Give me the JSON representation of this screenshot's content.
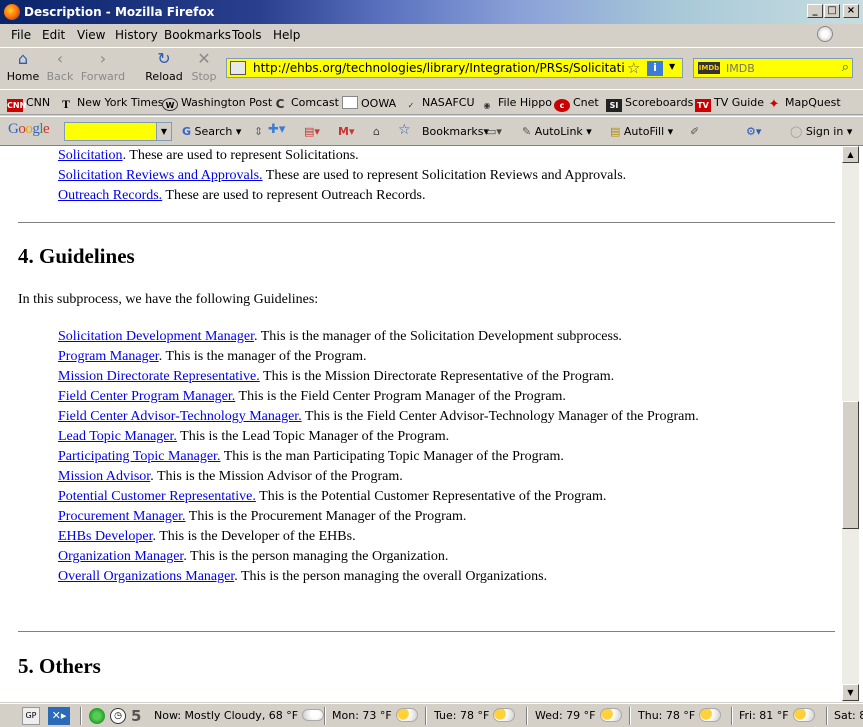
{
  "window": {
    "title": "Description - Mozilla Firefox"
  },
  "menu": [
    "File",
    "Edit",
    "View",
    "History",
    "Bookmarks",
    "Tools",
    "Help"
  ],
  "nav": {
    "home": "Home",
    "back": "Back",
    "forward": "Forward",
    "reload": "Reload",
    "stop": "Stop",
    "url": "http://ehbs.org/technologies/library/Integration/PRSs/Solicitation Developme",
    "search_placeholder": "IMDB",
    "search_engine": "IMDb"
  },
  "bookmarks": [
    "CNN",
    "New York Times",
    "Washington Post",
    "Comcast",
    "OOWA",
    "NASAFCU",
    "File Hippo",
    "Cnet",
    "Scoreboards",
    "TV Guide",
    "MapQuest"
  ],
  "google_toolbar": {
    "logo": "Google",
    "search": "Search",
    "bookmarks": "Bookmarks",
    "autolink": "AutoLink",
    "autofill": "AutoFill",
    "signin": "Sign in"
  },
  "content": {
    "top_items": [
      {
        "link": "Solicitation",
        "text": ". These are used to represent Solicitations."
      },
      {
        "link": "Solicitation Reviews and Approvals.",
        "text": " These are used to represent Solicitation Reviews and Approvals."
      },
      {
        "link": "Outreach Records.",
        "text": " These are used to represent Outreach Records."
      }
    ],
    "section4_heading": "4. Guidelines",
    "section4_intro": "In this subprocess, we have the following Guidelines:",
    "guidelines": [
      {
        "link": "Solicitation Development Manager",
        "text": ". This is the manager of the Solicitation Development subprocess."
      },
      {
        "link": "Program Manager",
        "text": ". This is the manager of the Program."
      },
      {
        "link": "Mission Directorate Representative.",
        "text": " This is the Mission Directorate Representative of the Program."
      },
      {
        "link": "Field Center Program Manager.",
        "text": " This is the Field Center Program Manager of the Program."
      },
      {
        "link": "Field Center Advisor-Technology Manager.",
        "text": " This is the Field Center Advisor-Technology Manager of the Program."
      },
      {
        "link": "Lead Topic Manager.",
        "text": " This is the Lead Topic Manager of the Program."
      },
      {
        "link": "Participating Topic Manager.",
        "text": " This is the man Participating Topic Manager of the Program."
      },
      {
        "link": "Mission Advisor",
        "text": ". This is the Mission Advisor of the Program."
      },
      {
        "link": "Potential Customer Representative.",
        "text": " This is the Potential Customer Representative of the Program."
      },
      {
        "link": "Procurement Manager.",
        "text": " This is the Procurement Manager of the Program."
      },
      {
        "link": "EHBs Developer",
        "text": ". This is the Developer of the EHBs."
      },
      {
        "link": "Organization Manager",
        "text": ". This is the person managing the Organization."
      },
      {
        "link": "Overall Organizations Manager",
        "text": ". This is the person managing the overall Organizations."
      }
    ],
    "section5_heading": "5. Others"
  },
  "status": {
    "gp": "GP",
    "count": "5",
    "now": "Now: Mostly Cloudy, 68 °F",
    "forecast": [
      "Mon: 73 °F",
      "Tue: 78 °F",
      "Wed: 79 °F",
      "Thu: 78 °F",
      "Fri: 81 °F",
      "Sat: 8"
    ]
  }
}
